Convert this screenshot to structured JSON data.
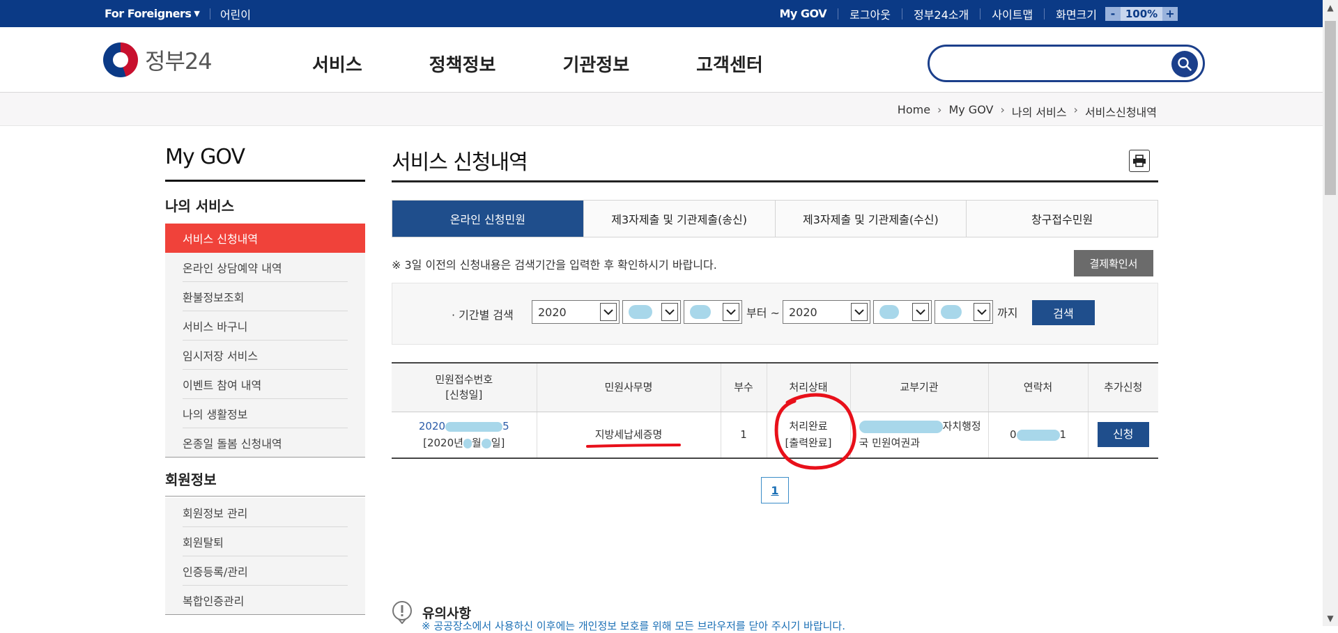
{
  "topbar": {
    "foreigners": "For Foreigners",
    "kids": "어린이",
    "links": [
      "My GOV",
      "로그아웃",
      "정부24소개",
      "사이트맵"
    ],
    "zoom_label": "화면크기",
    "zoom_minus": "-",
    "zoom_value": "100%",
    "zoom_plus": "+"
  },
  "header": {
    "logo_text": "정부24",
    "nav": [
      "서비스",
      "정책정보",
      "기관정보",
      "고객센터"
    ],
    "search_placeholder": ""
  },
  "breadcrumb": [
    "Home",
    "My GOV",
    "나의 서비스",
    "서비스신청내역"
  ],
  "sidebar": {
    "title": "My GOV",
    "section1": "나의 서비스",
    "items1": [
      "서비스 신청내역",
      "온라인 상담예약 내역",
      "환불정보조회",
      "서비스 바구니",
      "임시저장 서비스",
      "이벤트 참여 내역",
      "나의 생활정보",
      "온종일 돌봄 신청내역"
    ],
    "section2": "회원정보",
    "items2": [
      "회원정보 관리",
      "회원탈퇴",
      "인증등록/관리",
      "복합인증관리"
    ]
  },
  "content": {
    "title": "서비스 신청내역",
    "tabs": [
      "온라인 신청민원",
      "제3자제출 및 기관제출(송신)",
      "제3자제출 및 기관제출(수신)",
      "창구접수민원"
    ],
    "notice": "※ 3일 이전의 신청내용은 검색기간을 입력한 후 확인하시기 바랍니다.",
    "receipt_button": "결제확인서",
    "filter": {
      "label": "· 기간별 검색",
      "start_year": "2020",
      "from_text": "부터 ~",
      "end_year": "2020",
      "to_text": "까지",
      "search_button": "검색"
    },
    "table": {
      "headers": [
        "민원접수번호",
        "[신청일]",
        "민원사무명",
        "부수",
        "처리상태",
        "교부기관",
        "연락처",
        "추가신청"
      ],
      "row": {
        "receipt_no_start": "2020",
        "receipt_no_end": "5",
        "date_start": "[2020년",
        "date_mid": "월",
        "date_end": "일]",
        "service_name": "지방세납세증명",
        "count": "1",
        "status_line1": "처리완료",
        "status_line2": "[출력완료]",
        "agency_line1": "자치행정",
        "agency_line2": "국 민원여권과",
        "contact_start": "0",
        "contact_end": "1",
        "apply_button": "신청"
      }
    },
    "pager_current": "1",
    "caution_title": "유의사항",
    "caution_text": "※ 공공장소에서 사용하신 이후에는 개인정보 보호를 위해 모든 브라우저를 닫아 주시기 바랍니다."
  },
  "colors": {
    "topbar": "#0b3a86",
    "active_tab": "#1f4e8c",
    "sidebar_active": "#f0423a",
    "annotation": "#e8101a",
    "redaction": "#9ed3e8"
  }
}
